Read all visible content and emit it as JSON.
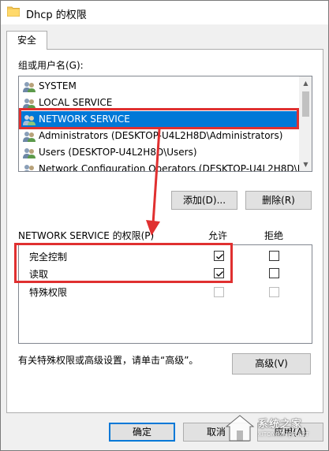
{
  "window": {
    "title": "Dhcp 的权限",
    "tab_label": "安全"
  },
  "groups": {
    "label": "组或用户名(G):",
    "items": [
      {
        "name": "SYSTEM"
      },
      {
        "name": "LOCAL SERVICE"
      },
      {
        "name": "NETWORK SERVICE",
        "selected": true
      },
      {
        "name": "Administrators (DESKTOP-U4L2H8D\\Administrators)"
      },
      {
        "name": "Users (DESKTOP-U4L2H8D\\Users)"
      },
      {
        "name": "Network Configuration Operators (DESKTOP-U4L2H8D\\Ne..."
      }
    ]
  },
  "buttons": {
    "add": "添加(D)...",
    "remove": "删除(R)",
    "advanced": "高级(V)",
    "ok": "确定",
    "cancel": "取消",
    "apply": "应用(A)"
  },
  "permissions": {
    "header": "NETWORK SERVICE 的权限(P)",
    "allow_label": "允许",
    "deny_label": "拒绝",
    "rows": [
      {
        "name": "完全控制",
        "allow": true,
        "deny": false,
        "enabled": true
      },
      {
        "name": "读取",
        "allow": true,
        "deny": false,
        "enabled": true
      },
      {
        "name": "特殊权限",
        "allow": false,
        "deny": false,
        "enabled": false
      }
    ]
  },
  "advanced_hint": "有关特殊权限或高级设置，请单击“高级”。",
  "watermark": {
    "text": "系统之家",
    "sub": "XITONGZHIJIA.NET"
  },
  "colors": {
    "selection": "#0078d7",
    "annotation_red": "#e03030"
  }
}
